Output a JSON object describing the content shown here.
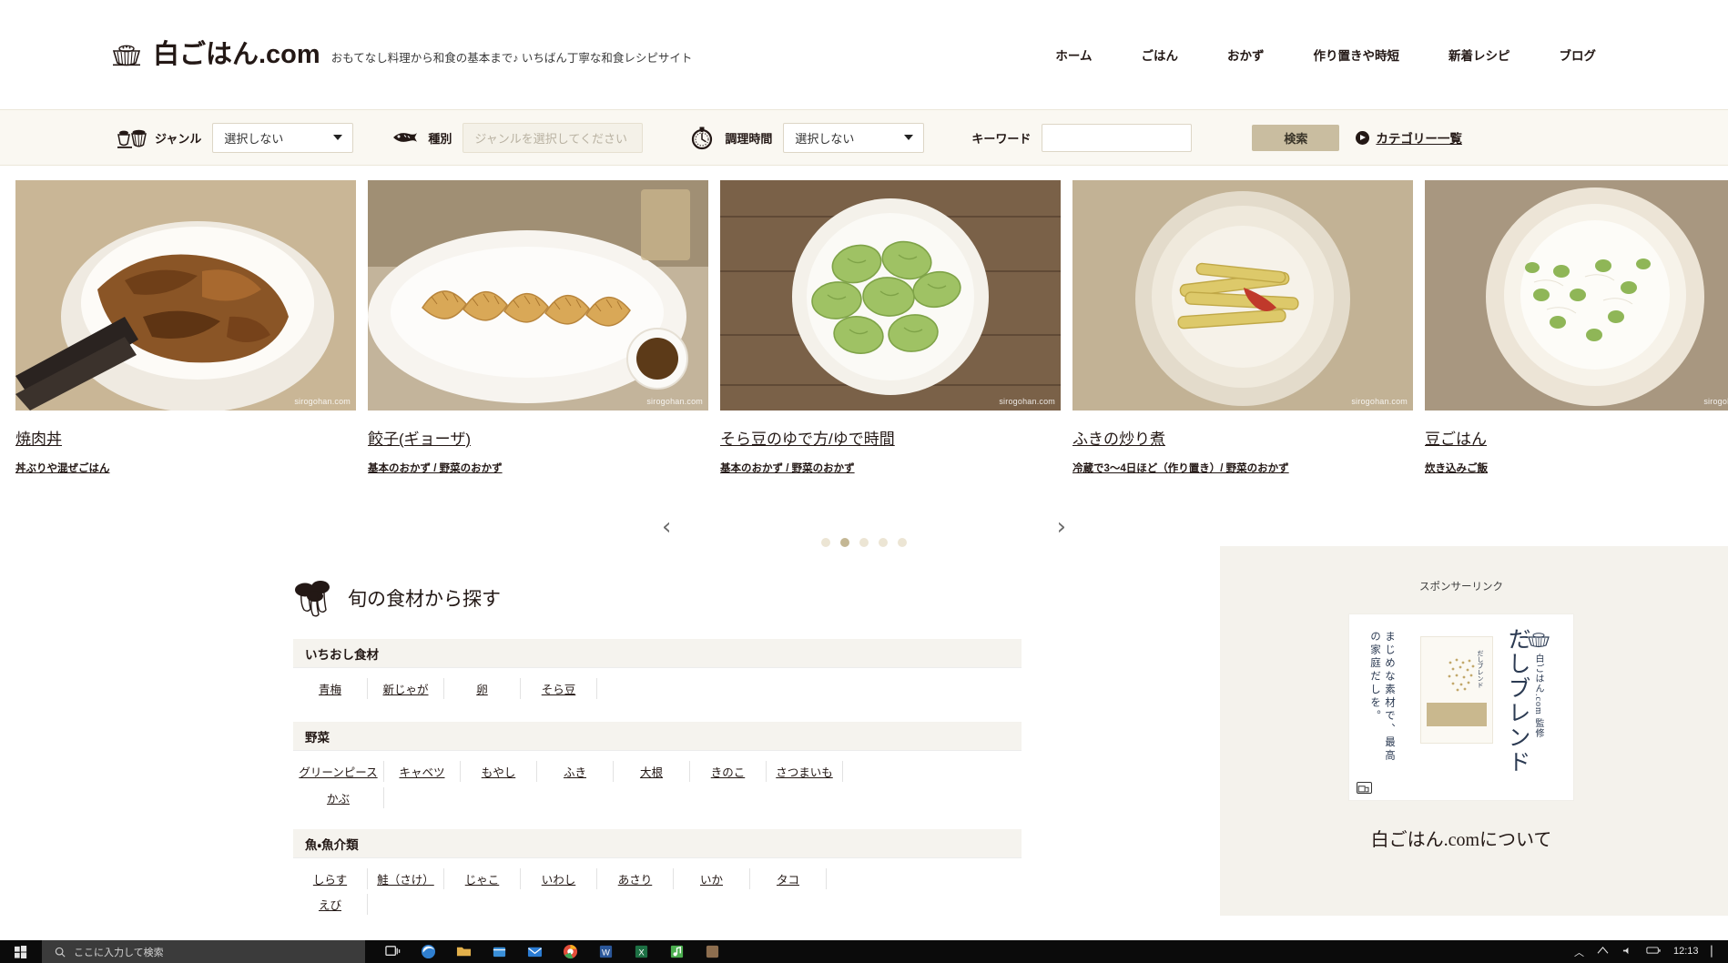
{
  "header": {
    "logo_text": "白ごはん.com",
    "logo_icon": "rice-bowl-icon",
    "tagline": "おもてなし料理から和食の基本まで♪ いちばん丁寧な和食レシピサイト",
    "nav": [
      {
        "label": "ホーム",
        "name": "nav-home"
      },
      {
        "label": "ごはん",
        "name": "nav-gohan"
      },
      {
        "label": "おかず",
        "name": "nav-okazu"
      },
      {
        "label": "作り置きや時短",
        "name": "nav-tsukurioki"
      },
      {
        "label": "新着レシピ",
        "name": "nav-new-recipes"
      },
      {
        "label": "ブログ",
        "name": "nav-blog"
      }
    ]
  },
  "search": {
    "genre_label": "ジャンル",
    "genre_value": "選択しない",
    "type_label": "種別",
    "type_placeholder": "ジャンルを選択してください",
    "time_label": "調理時間",
    "time_value": "選択しない",
    "keyword_label": "キーワード",
    "keyword_value": "",
    "search_button": "検索",
    "category_link": "カテゴリー一覧"
  },
  "carousel": {
    "prev": "‹",
    "next": "›",
    "active_dot": 1,
    "dot_count": 5,
    "cards": [
      {
        "title": "焼肉丼",
        "subtitle": "丼ぶりや混ぜごはん",
        "watermark": "sirogohan.com",
        "image": "yakiniku-don-photo"
      },
      {
        "title": "餃子(ギョーザ)",
        "subtitle": "基本のおかず / 野菜のおかず",
        "watermark": "sirogohan.com",
        "image": "gyoza-photo"
      },
      {
        "title": "そら豆のゆで方/ゆで時間",
        "subtitle": "基本のおかず / 野菜のおかず",
        "watermark": "sirogohan.com",
        "image": "soramame-photo"
      },
      {
        "title": "ふきの炒り煮",
        "subtitle": "冷蔵で3〜4日ほど（作り置き）/ 野菜のおかず",
        "watermark": "sirogohan.com",
        "image": "fuki-irini-photo"
      },
      {
        "title": "豆ごはん",
        "subtitle": "炊き込みご飯",
        "watermark": "sirogohan.com",
        "image": "mame-gohan-photo"
      }
    ]
  },
  "seasonal": {
    "title": "旬の食材から探す",
    "icon": "mushroom-icon",
    "groups": [
      {
        "heading": "いちおし食材",
        "items": [
          "青梅",
          "新じゃが",
          "卵",
          "そら豆"
        ]
      },
      {
        "heading": "野菜",
        "items": [
          "グリーンピース",
          "キャベツ",
          "もやし",
          "ふき",
          "大根",
          "きのこ",
          "さつまいも",
          "かぶ"
        ]
      },
      {
        "heading": "魚・魚介類",
        "items": [
          "しらす",
          "鮭（さけ）",
          "じゃこ",
          "いわし",
          "あさり",
          "いか",
          "タコ",
          "えび"
        ]
      }
    ]
  },
  "sidebar": {
    "sponsor_label": "スポンサーリンク",
    "ad": {
      "brand_vertical": "白ごはん.com 監修",
      "product_name": "だしブレンド",
      "copy": "まじめな素材で、最高の家庭だしを。",
      "package_label": "だしブレンド",
      "bowl_icon": "rice-bowl-icon",
      "adchoices_icon": "ad-choices-icon"
    },
    "about_title": "白ごはん.comについて"
  },
  "taskbar": {
    "start_icon": "windows-start-icon",
    "search_placeholder": "ここに入力して検索",
    "search_icon": "search-icon",
    "clock_time": "12:13",
    "tray_icons": [
      "task-view-icon",
      "edge-icon",
      "folder-icon",
      "store-icon",
      "mail-icon",
      "chrome-icon",
      "word-icon",
      "excel-icon",
      "music-icon"
    ]
  },
  "colors": {
    "accent": "#c9bda0",
    "searchbar_bg": "#faf8f2",
    "panel_bg": "#f4f2ec",
    "text": "#231815"
  }
}
